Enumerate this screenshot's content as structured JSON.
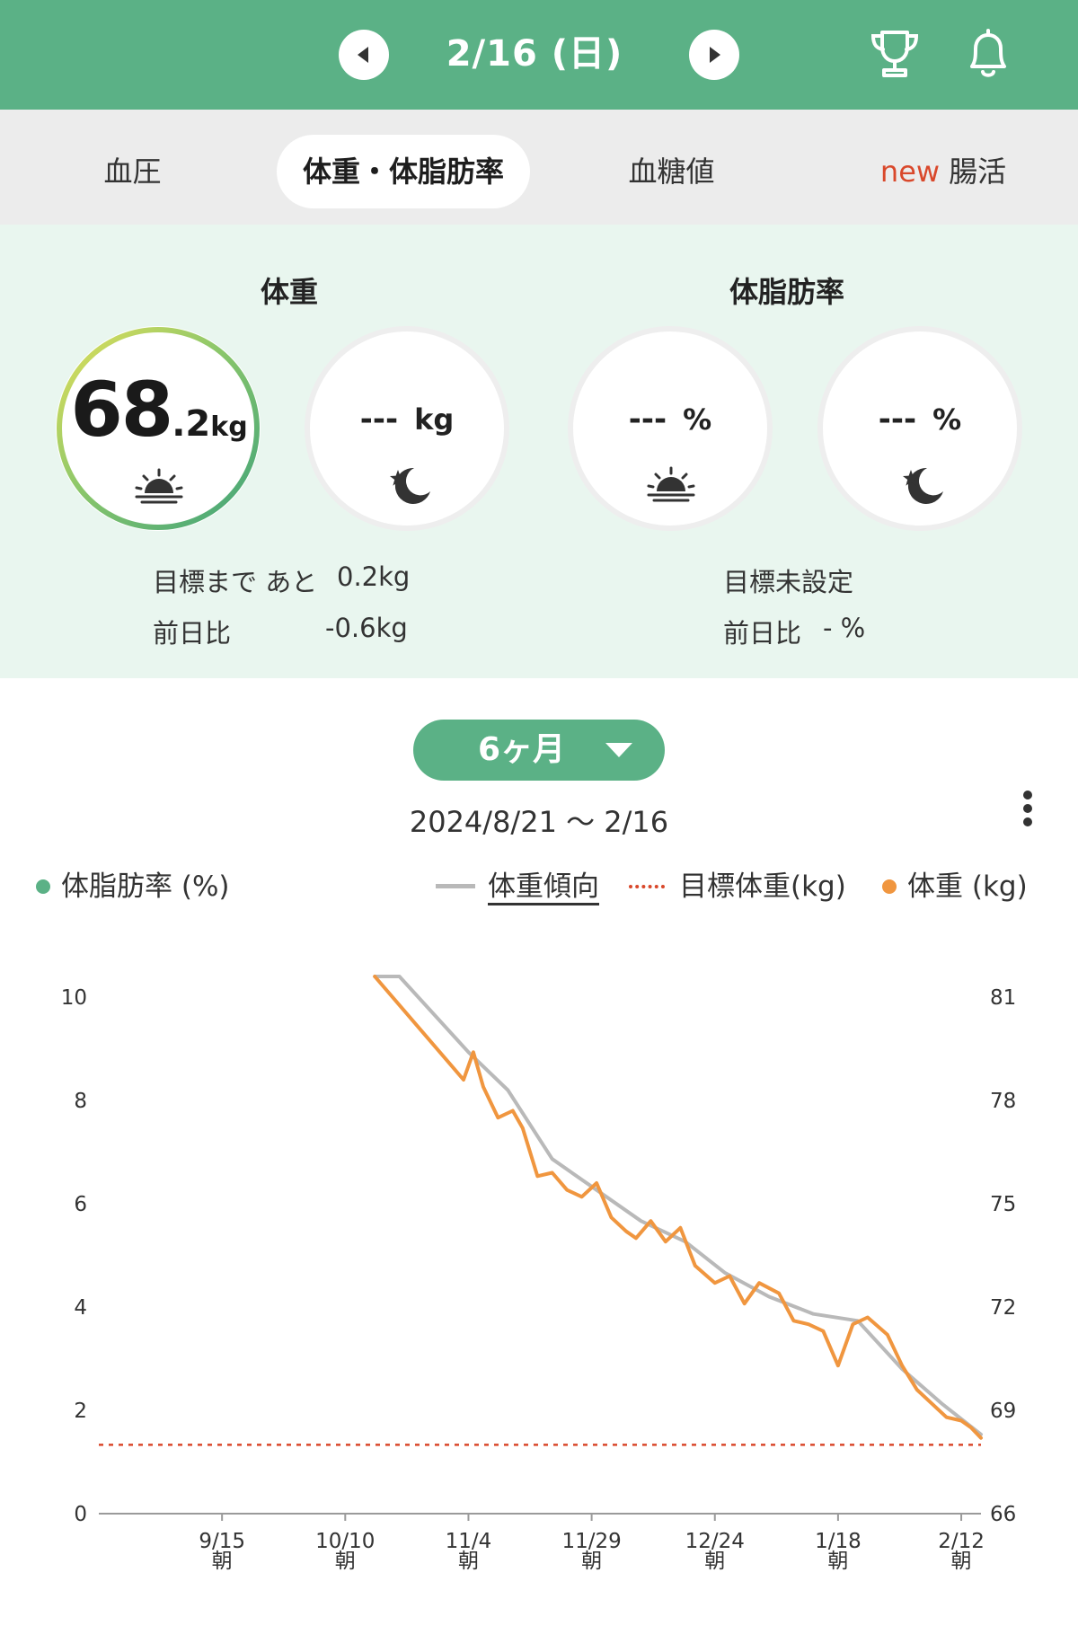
{
  "header": {
    "date": "2/16 (日)",
    "prev_icon": "triangle-left-icon",
    "next_icon": "triangle-right-icon",
    "trophy_icon": "trophy-icon",
    "bell_icon": "bell-icon",
    "accent_color": "#5bb186"
  },
  "tabs": [
    {
      "label": "血圧",
      "active": false
    },
    {
      "label": "体重・体脂肪率",
      "active": true
    },
    {
      "label": "血糖値",
      "active": false
    },
    {
      "badge": "new",
      "label": "腸活",
      "active": false
    }
  ],
  "weight": {
    "title": "体重",
    "morning": {
      "int": "68",
      "dec": ".2",
      "unit": "kg",
      "icon": "sunrise-icon"
    },
    "evening": {
      "value": "---",
      "unit": "kg",
      "icon": "moon-star-icon"
    },
    "goal_text": "目標まで あと",
    "goal_value": "0.2kg",
    "diff_label": "前日比",
    "diff_value": "-0.6kg"
  },
  "bodyfat": {
    "title": "体脂肪率",
    "morning": {
      "value": "---",
      "unit": "%",
      "icon": "sunrise-icon"
    },
    "evening": {
      "value": "---",
      "unit": "%",
      "icon": "moon-star-icon"
    },
    "goal_text": "目標未設定",
    "diff_label": "前日比",
    "diff_value": "- %"
  },
  "period": {
    "label": "6ヶ月",
    "icon": "caret-down-icon"
  },
  "range": "2024/8/21 〜 2/16",
  "menu_icon": "more-vertical-icon",
  "legend": {
    "bodyfat": "体脂肪率 (%)",
    "trend": "体重傾向",
    "goal": "目標体重(kg)",
    "weight": "体重 (kg)"
  },
  "chart_data": {
    "type": "line",
    "x_ticks": [
      {
        "date": "9/15",
        "sub": "朝"
      },
      {
        "date": "10/10",
        "sub": "朝"
      },
      {
        "date": "11/4",
        "sub": "朝"
      },
      {
        "date": "11/29",
        "sub": "朝"
      },
      {
        "date": "12/24",
        "sub": "朝"
      },
      {
        "date": "1/18",
        "sub": "朝"
      },
      {
        "date": "2/12",
        "sub": "朝"
      }
    ],
    "y_left": {
      "label": "体脂肪率 (%)",
      "min": 0,
      "max": 10,
      "ticks": [
        0,
        2,
        4,
        6,
        8,
        10
      ]
    },
    "y_right": {
      "label": "体重 (kg)",
      "min": 66,
      "max": 81,
      "ticks": [
        66,
        69,
        72,
        75,
        78,
        81
      ]
    },
    "goal_weight": 68,
    "series": [
      {
        "name": "体重 (kg)",
        "color": "#f0963f",
        "points": [
          [
            "2024-10-16",
            81.6
          ],
          [
            "2024-11-03",
            78.6
          ],
          [
            "2024-11-05",
            79.4
          ],
          [
            "2024-11-07",
            78.4
          ],
          [
            "2024-11-10",
            77.5
          ],
          [
            "2024-11-13",
            77.7
          ],
          [
            "2024-11-15",
            77.2
          ],
          [
            "2024-11-18",
            75.8
          ],
          [
            "2024-11-21",
            75.9
          ],
          [
            "2024-11-24",
            75.4
          ],
          [
            "2024-11-27",
            75.2
          ],
          [
            "2024-11-30",
            75.6
          ],
          [
            "2024-12-03",
            74.6
          ],
          [
            "2024-12-06",
            74.2
          ],
          [
            "2024-12-08",
            74.0
          ],
          [
            "2024-12-11",
            74.5
          ],
          [
            "2024-12-14",
            73.9
          ],
          [
            "2024-12-17",
            74.3
          ],
          [
            "2024-12-20",
            73.2
          ],
          [
            "2024-12-24",
            72.7
          ],
          [
            "2024-12-27",
            72.9
          ],
          [
            "2024-12-30",
            72.1
          ],
          [
            "2025-01-02",
            72.7
          ],
          [
            "2025-01-06",
            72.4
          ],
          [
            "2025-01-09",
            71.6
          ],
          [
            "2025-01-12",
            71.5
          ],
          [
            "2025-01-15",
            71.3
          ],
          [
            "2025-01-18",
            70.3
          ],
          [
            "2025-01-21",
            71.5
          ],
          [
            "2025-01-24",
            71.7
          ],
          [
            "2025-01-28",
            71.2
          ],
          [
            "2025-01-31",
            70.3
          ],
          [
            "2025-02-03",
            69.6
          ],
          [
            "2025-02-06",
            69.2
          ],
          [
            "2025-02-09",
            68.8
          ],
          [
            "2025-02-12",
            68.7
          ],
          [
            "2025-02-14",
            68.5
          ],
          [
            "2025-02-16",
            68.2
          ]
        ]
      },
      {
        "name": "体重傾向",
        "color": "#b9b9b9",
        "points": [
          [
            "2024-10-16",
            81.6
          ],
          [
            "2024-10-21",
            81.6
          ],
          [
            "2024-11-04",
            79.4
          ],
          [
            "2024-11-12",
            78.3
          ],
          [
            "2024-11-21",
            76.3
          ],
          [
            "2024-11-30",
            75.4
          ],
          [
            "2024-12-09",
            74.5
          ],
          [
            "2024-12-18",
            73.9
          ],
          [
            "2024-12-26",
            73.0
          ],
          [
            "2025-01-04",
            72.3
          ],
          [
            "2025-01-13",
            71.8
          ],
          [
            "2025-01-22",
            71.6
          ],
          [
            "2025-01-31",
            70.2
          ],
          [
            "2025-02-08",
            69.2
          ],
          [
            "2025-02-16",
            68.3
          ]
        ]
      }
    ]
  }
}
